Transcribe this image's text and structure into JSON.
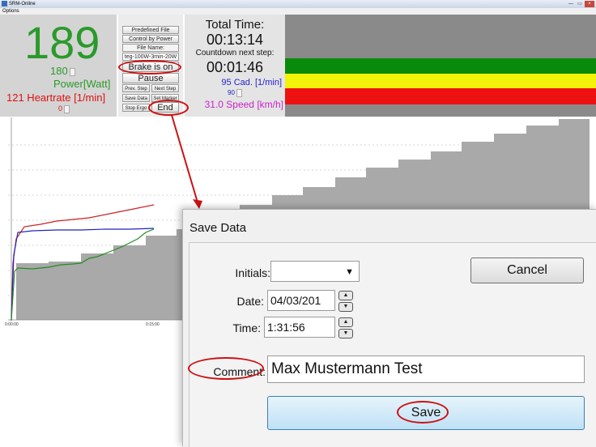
{
  "window": {
    "title": "SRM-Online",
    "menu": "Options",
    "min": "—",
    "max": "▭",
    "close": "×"
  },
  "status": {
    "power_big": "189",
    "power_set": "180",
    "power_label": "Power[Watt]",
    "heartrate": "121 Heartrate [1/min]",
    "heartrate_zero": "0"
  },
  "controls": {
    "predefined_file": "Predefined File",
    "control_by_power": "Control by Power",
    "file_name_label": "File Name:",
    "file_name_value": "teg-100W-3min-20W",
    "brake_is_on": "Brake is on",
    "pause": "Pause",
    "prev_step": "Prev. Step",
    "next_step": "Next Step",
    "save_data": "Save Data",
    "set_marker": "Set Marker",
    "stop_ergo": "Stop Ergo",
    "end": "End"
  },
  "timing": {
    "total_label": "Total Time:",
    "total_value": "00:13:14",
    "countdown_label": "Countdown next step:",
    "countdown_value": "00:01:46",
    "cadence": "95 Cad. [1/min]",
    "cadence_set": "90",
    "speed": "31.0 Speed [km/h]"
  },
  "bands": {
    "green": "#0a8a0a",
    "yellow": "#f2f20a",
    "red": "#ee1111",
    "gray": "#8a8a8a"
  },
  "chart": {
    "start_time": "0:00:00",
    "mid_time": "0:15:00",
    "heartrate_color": "#cc2222",
    "cadence_color": "#2222bb",
    "power_color": "#228b22"
  },
  "dialog": {
    "title": "Save Data",
    "initials_label": "Initials:",
    "initials_value": "",
    "date_label": "Date:",
    "date_value": "04/03/201",
    "time_label": "Time:",
    "time_value": "1:31:56",
    "comment_label": "Comment:",
    "comment_value": "Max Mustermann Test",
    "cancel_label": "Cancel",
    "save_label": "Save"
  }
}
